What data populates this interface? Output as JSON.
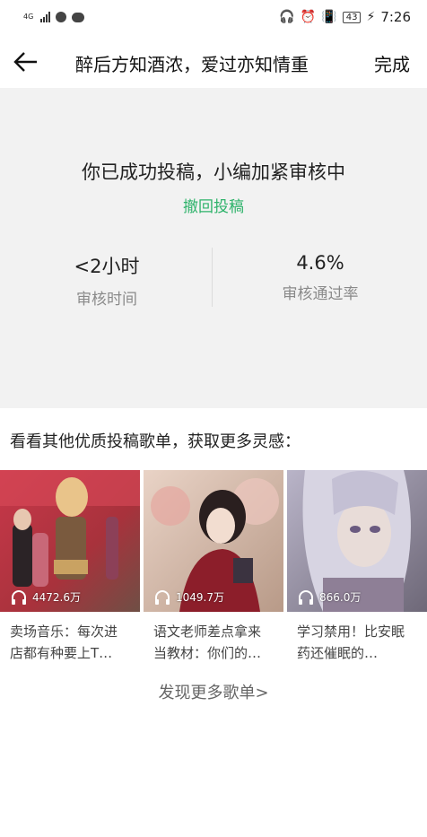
{
  "status_bar": {
    "network": "4G",
    "battery": "43",
    "time": "7:26"
  },
  "header": {
    "title": "醉后方知酒浓，爱过亦知情重",
    "done_label": "完成"
  },
  "review": {
    "message": "你已成功投稿，小编加紧审核中",
    "withdraw_label": "撤回投稿",
    "stats": [
      {
        "value": "<2小时",
        "label": "审核时间"
      },
      {
        "value": "4.6%",
        "label": "审核通过率"
      }
    ]
  },
  "recommendations": {
    "title": "看看其他优质投稿歌单，获取更多灵感：",
    "playlists": [
      {
        "plays": "4472.6万",
        "title": "卖场音乐：每次进店都有种要上T…"
      },
      {
        "plays": "1049.7万",
        "title": "语文老师差点拿来当教材：你们的…"
      },
      {
        "plays": "866.0万",
        "title": "学习禁用！比安眠药还催眠的…"
      }
    ],
    "more_label": "发现更多歌单>"
  }
}
